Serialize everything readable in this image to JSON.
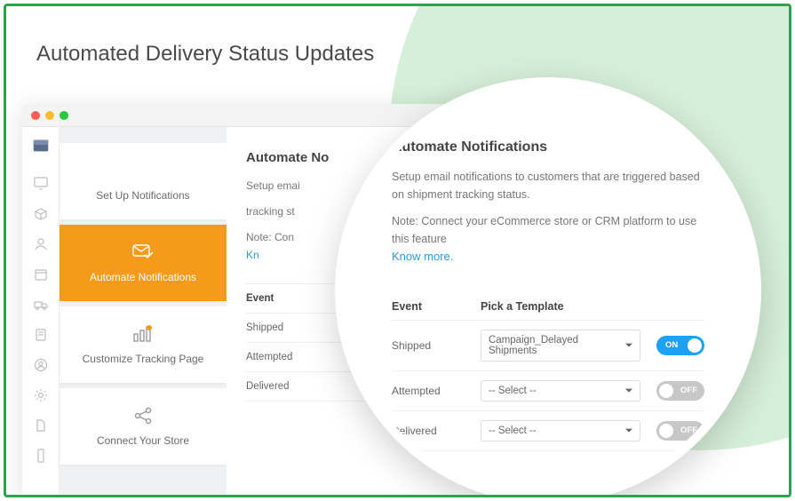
{
  "page_title": "Automated Delivery Status Updates",
  "colors": {
    "accent": "#f59a1a",
    "toggle_on": "#1ea1f2",
    "frame": "#2fa24f"
  },
  "iconbar": {
    "items": [
      {
        "name": "dashboard-icon"
      },
      {
        "name": "package-icon"
      },
      {
        "name": "customers-icon"
      },
      {
        "name": "calendar-icon"
      },
      {
        "name": "truck-icon"
      },
      {
        "name": "clipboard-icon"
      },
      {
        "name": "user-circle-icon"
      },
      {
        "name": "settings-icon"
      },
      {
        "name": "file-icon"
      },
      {
        "name": "phone-icon"
      }
    ]
  },
  "sidebar": {
    "items": [
      {
        "label": "Set Up Notifications",
        "icon": "bell-icon"
      },
      {
        "label": "Automate Notifications",
        "icon": "mail-check-icon",
        "active": true
      },
      {
        "label": "Customize Tracking Page",
        "icon": "chart-bars-icon"
      },
      {
        "label": "Connect Your Store",
        "icon": "share-nodes-icon"
      }
    ]
  },
  "content": {
    "heading_truncated": "Automate No",
    "heading": "Automate Notifications",
    "desc_truncated_1": "Setup emai",
    "desc_truncated_2": "tracking st",
    "desc": "Setup email notifications to customers that are triggered based on shipment tracking status.",
    "note_truncated": "Note: Con",
    "note": "Note: Connect your eCommerce store or CRM platform to use this feature",
    "link_truncated": "Kn",
    "link_label": "Know more.",
    "table": {
      "headers": {
        "event": "Event",
        "template": "Pick a Template"
      },
      "rows": [
        {
          "event": "Shipped",
          "template": "Campaign_Delayed Shipments",
          "toggle": "ON"
        },
        {
          "event": "Attempted",
          "template": "-- Select --",
          "toggle": "OFF"
        },
        {
          "event": "Delivered",
          "template": "-- Select --",
          "toggle": "OFF"
        }
      ]
    }
  }
}
